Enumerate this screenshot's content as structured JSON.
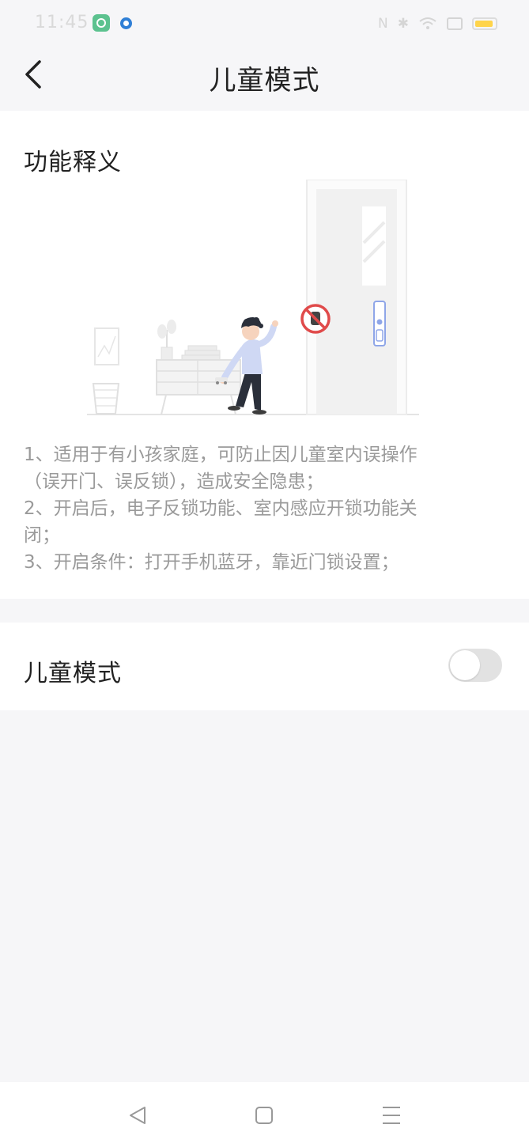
{
  "status_bar": {
    "time": "11:45",
    "icons": [
      "upload-app-icon",
      "browser-app-icon",
      "nfc-icon",
      "bluetooth-icon",
      "wifi-icon",
      "screen-icon",
      "battery-icon"
    ],
    "battery_color": "#ffd44a"
  },
  "header": {
    "title": "儿童模式"
  },
  "description": {
    "title": "功能释义",
    "lines": [
      "1、适用于有小孩家庭，可防止因儿童室内误操作",
      "（误开门、误反锁），造成安全隐患；",
      "2、开启后，电子反锁功能、室内感应开锁功能关",
      "闭；",
      "3、开启条件：打开手机蓝牙，靠近门锁设置；"
    ]
  },
  "setting": {
    "label": "儿童模式",
    "enabled": false
  },
  "system_nav": {
    "buttons": [
      "back-triangle-icon",
      "home-square-icon",
      "menu-lines-icon"
    ]
  },
  "colors": {
    "background": "#f6f6f8",
    "card": "#ffffff",
    "text_primary": "#222222",
    "text_secondary": "#9a9a9a",
    "toggle_off": "#e2e2e2",
    "prohibit_red": "#e04a4a",
    "accent_blue": "#8fa6e8"
  }
}
